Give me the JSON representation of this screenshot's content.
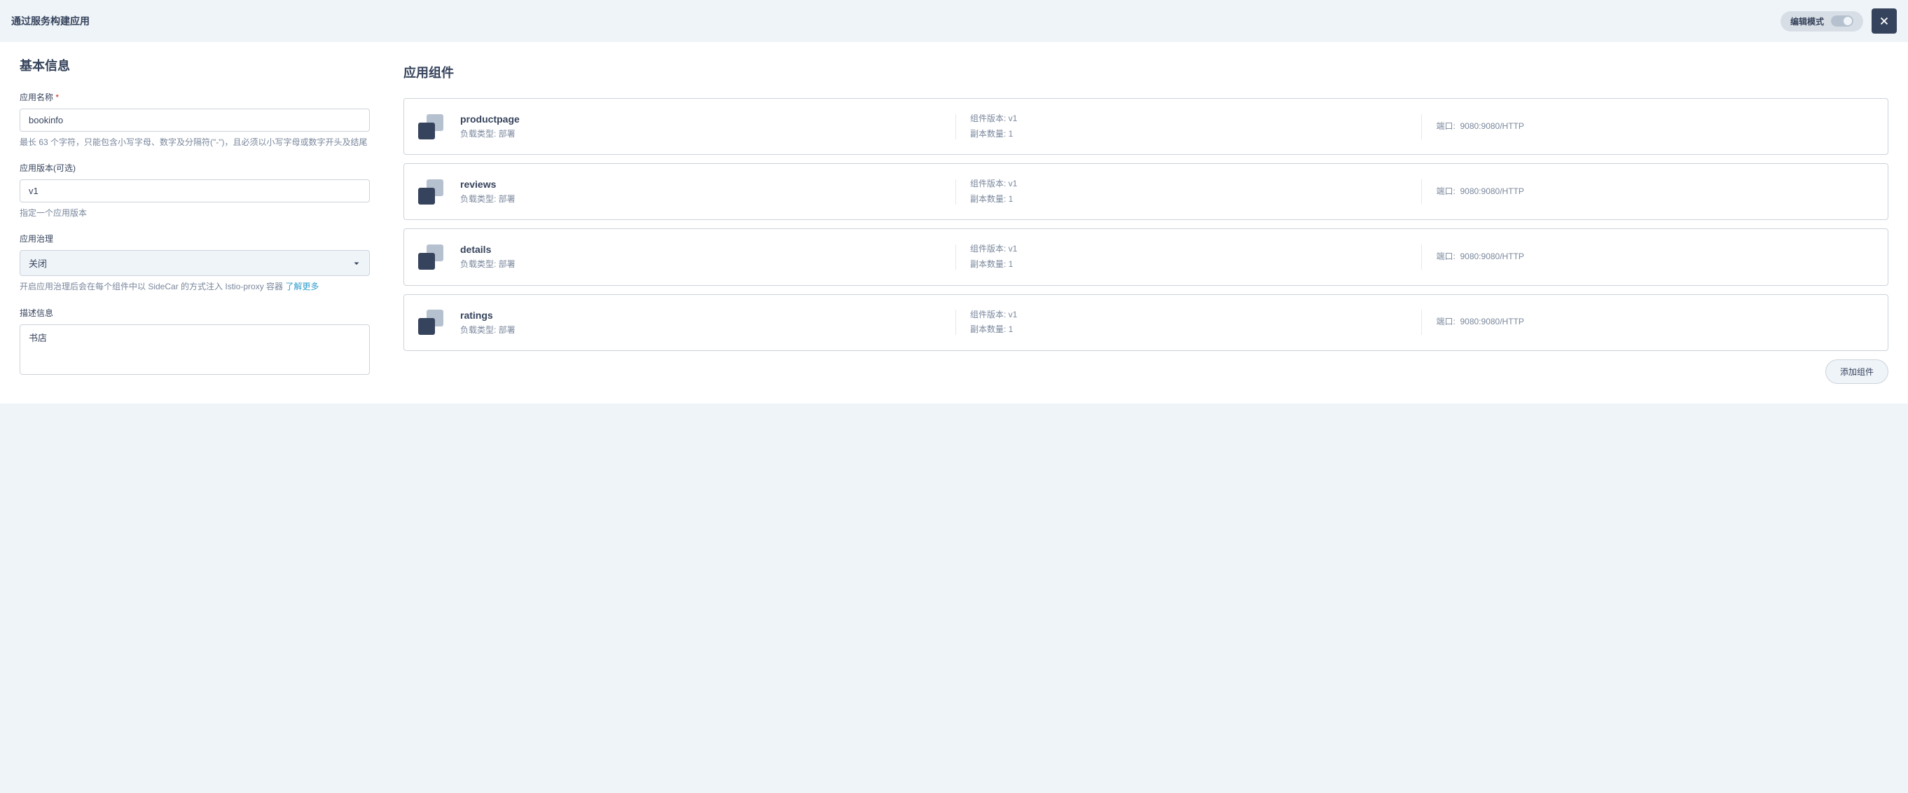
{
  "header": {
    "title": "通过服务构建应用",
    "edit_mode_label": "编辑模式"
  },
  "basic_info": {
    "section_title": "基本信息",
    "app_name": {
      "label": "应用名称",
      "value": "bookinfo",
      "hint": "最长 63 个字符，只能包含小写字母、数字及分隔符(\"-\")，且必须以小写字母或数字开头及结尾"
    },
    "app_version": {
      "label": "应用版本(可选)",
      "value": "v1",
      "hint": "指定一个应用版本"
    },
    "governance": {
      "label": "应用治理",
      "value": "关闭",
      "hint": "开启应用治理后会在每个组件中以 SideCar 的方式注入 Istio-proxy 容器 ",
      "learn_more": "了解更多"
    },
    "description": {
      "label": "描述信息",
      "value": "书店"
    }
  },
  "components": {
    "section_title": "应用组件",
    "labels": {
      "workload_type": "负载类型",
      "component_version": "组件版本",
      "replicas": "副本数量",
      "port": "端口"
    },
    "items": [
      {
        "name": "productpage",
        "workload_type": "部署",
        "component_version": "v1",
        "replicas": "1",
        "port": "9080:9080/HTTP"
      },
      {
        "name": "reviews",
        "workload_type": "部署",
        "component_version": "v1",
        "replicas": "1",
        "port": "9080:9080/HTTP"
      },
      {
        "name": "details",
        "workload_type": "部署",
        "component_version": "v1",
        "replicas": "1",
        "port": "9080:9080/HTTP"
      },
      {
        "name": "ratings",
        "workload_type": "部署",
        "component_version": "v1",
        "replicas": "1",
        "port": "9080:9080/HTTP"
      }
    ],
    "add_button": "添加组件"
  }
}
